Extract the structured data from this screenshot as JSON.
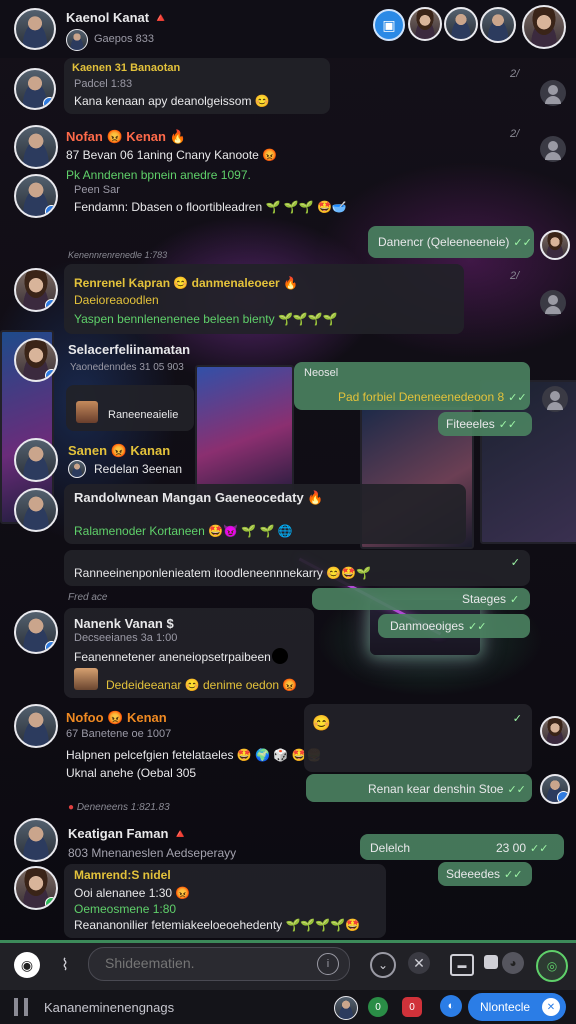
{
  "header": {
    "title": "Kaenol Kanat 🔺",
    "subtitle": "Gaepos 833"
  },
  "timestamps": {
    "t1": "2/",
    "t2": "2/",
    "t3": "2/",
    "section1": "Kenennrenrenedle 1:783",
    "section2": "Fred ace",
    "section3": "Deneneens 1:821.83"
  },
  "messages": {
    "m1": {
      "name": "Kaenen 31 Banaotan",
      "meta": "Padcel 1:83",
      "text": "Kana kenaan apy deanolgeissom 😊"
    },
    "m2": {
      "name": "Nofan 😡 Kenan",
      "name_icon": "🔥",
      "meta": "87 Bevan 06 1aning Cnany Kanoote 😡",
      "line2": "Pk Anndenen bpnein anedre 1097.",
      "name3": "Peen Sar",
      "text3": "Fendamn: Dbasen o floortibleadren 🌱 🌱🌱 🤩🥣"
    },
    "out1": {
      "text": "Danencr (Qeleeneeneie)"
    },
    "m3": {
      "name": "Renrenel Kapran 😊 danmenaleoeer 🔥",
      "line2": "Daeioreaoodlen",
      "line3": "Yaspen bennlenenenee beleen bienty 🌱🌱🌱🌱"
    },
    "m4": {
      "name": "Selacerfeliinamatan",
      "meta": "Yaonedenndes 31 05 903",
      "text": "Raneeneaielie"
    },
    "out2": {
      "header": "Neosel",
      "text": "Pad forbiel Deneneenedeoon 8"
    },
    "out3": {
      "text": "Fiteeeles"
    },
    "m5": {
      "name": "Sanen 😡 Kanan",
      "meta": "Redelan 3eenan"
    },
    "m6": {
      "name": "Randolwnean Mangan Gaeneocedaty 🔥",
      "text": "Ralamenoder Kortaneen 🤩😈 🌱 🌱 🌐"
    },
    "m7": {
      "text": "Ranneeinenponlenieatem itoodleneennnekarry 😊🤩🌱"
    },
    "out4": {
      "text": "Staeges"
    },
    "out5": {
      "text": "Danmoeoiges"
    },
    "m8": {
      "name": "Nanenk Vanan $",
      "meta": "Decseeianes 3a 1:00",
      "text": "Feanennetener aneneiopsetrpaibeen",
      "line2": "Dedeideeanar 😊 denime oedon 😡"
    },
    "m9": {
      "name": "Nofoo 😡 Kenan",
      "meta": "67 Banetene oe 1007",
      "text": "Halpnen pelcefgien fetelataeles 🤩 🌍 🎲 🤩🍔",
      "line2": "Uknal anehe (Oebal 305"
    },
    "out6": {
      "text": "😊"
    },
    "out7": {
      "text": "Renan kear denshin Stoe"
    },
    "m10": {
      "name": "Keatigan Faman 🔺",
      "meta": "803 Mnenaneslen Aedseperayy"
    },
    "out8": {
      "text": "Delelch",
      "time": "23 00"
    },
    "out9": {
      "text": "Sdeeedes"
    },
    "m11": {
      "name": "Mamrend:S nidel",
      "meta": "Ooi alenanee 1:30 😡",
      "line2": "Oemeosmene 1:80",
      "text": "Reananonilier fetemiakeeloeoehedenty 🌱🌱🌱🌱🤩"
    }
  },
  "composer": {
    "placeholder": "Shideematien.",
    "icons": [
      "camera-icon",
      "attach-icon",
      "emoji-icon",
      "mute-icon",
      "sticker-icon",
      "settings-icon",
      "send-icon"
    ]
  },
  "bottom": {
    "label": "Kananeminenengnags",
    "pill": "Nlontecle"
  },
  "colors": {
    "out_bubble": "#4a8060",
    "in_bubble": "#222228",
    "accent": "#2b7de6",
    "name_yellow": "#e3c23b",
    "name_orange": "#f08a22",
    "green_text": "#5fd06a"
  }
}
